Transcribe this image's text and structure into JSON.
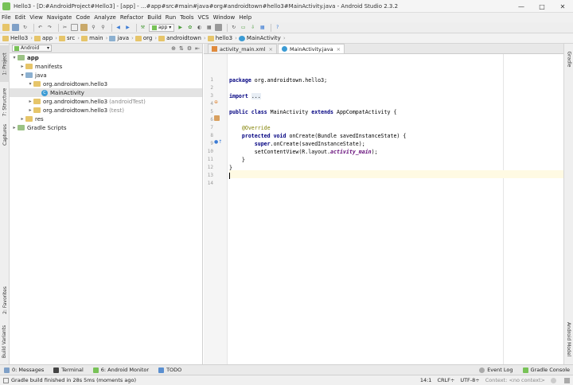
{
  "window": {
    "title": "Hello3 - [D:#AndroidProject#Hello3] - [app] - ...#app#src#main#java#org#androidtown#hello3#MainActivity.java - Android Studio 2.3.2"
  },
  "menu": [
    "File",
    "Edit",
    "View",
    "Navigate",
    "Code",
    "Analyze",
    "Refactor",
    "Build",
    "Run",
    "Tools",
    "VCS",
    "Window",
    "Help"
  ],
  "toolbar": {
    "run_config": "app"
  },
  "breadcrumbs": [
    "Hello3",
    "app",
    "src",
    "main",
    "java",
    "org",
    "androidtown",
    "hello3",
    "MainActivity"
  ],
  "left_tabs": [
    "1: Project",
    "7: Structure",
    "Captures",
    "2: Favorites",
    "Build Variants"
  ],
  "right_tabs": [
    "Gradle",
    "Android Model"
  ],
  "project": {
    "view_mode": "Android",
    "tree": [
      {
        "label": "app",
        "note": "",
        "bold": true
      },
      {
        "label": "manifests",
        "note": ""
      },
      {
        "label": "java",
        "note": ""
      },
      {
        "label": "org.androidtown.hello3",
        "note": ""
      },
      {
        "label": "MainActivity",
        "note": ""
      },
      {
        "label": "org.androidtown.hello3",
        "note": "(androidTest)"
      },
      {
        "label": "org.androidtown.hello3",
        "note": "(test)"
      },
      {
        "label": "res",
        "note": ""
      },
      {
        "label": "Gradle Scripts",
        "note": ""
      }
    ]
  },
  "editor": {
    "tabs": [
      "activity_main.xml",
      "MainActivity.java"
    ],
    "line_numbers": [
      "1",
      "2",
      "3",
      "4",
      "5",
      "6",
      "7",
      "8",
      "9",
      "10",
      "11",
      "12",
      "13",
      "14"
    ]
  },
  "bottom_tools": [
    "0: Messages",
    "Terminal",
    "6: Android Monitor",
    "TODO"
  ],
  "bottom_right_tools": [
    "Event Log",
    "Gradle Console"
  ],
  "status": {
    "message": "Gradle build finished in 28s 5ms (moments ago)",
    "position": "14:1",
    "line_sep": "CRLF÷",
    "encoding": "UTF-8÷",
    "context": "Context: <no context>"
  },
  "colors": {
    "accent": "#3b9bd4",
    "current_line": "#fffae3",
    "keyword": "#000080",
    "annotation": "#808000"
  }
}
